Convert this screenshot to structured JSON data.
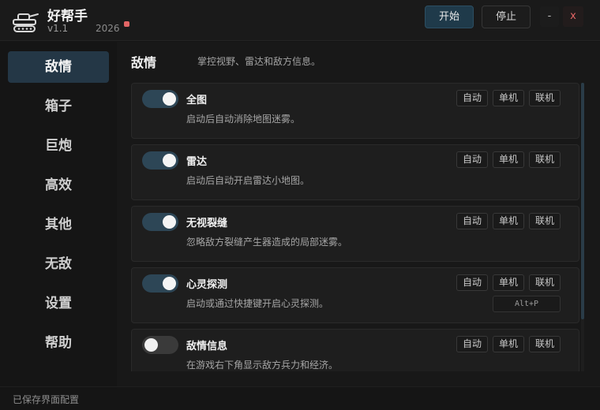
{
  "app": {
    "title": "好帮手",
    "version": "v1.1",
    "year": "2026",
    "start_label": "开始",
    "stop_label": "停止",
    "minimize_label": "-",
    "close_label": "x",
    "accent_color": "#243746",
    "status_dot_color": "#e26565",
    "logo_icon": "tank-icon"
  },
  "sidebar": {
    "items": [
      {
        "label": "敌情",
        "active": true
      },
      {
        "label": "箱子",
        "active": false
      },
      {
        "label": "巨炮",
        "active": false
      },
      {
        "label": "高效",
        "active": false
      },
      {
        "label": "其他",
        "active": false
      },
      {
        "label": "无敌",
        "active": false
      },
      {
        "label": "设置",
        "active": false
      },
      {
        "label": "帮助",
        "active": false
      }
    ]
  },
  "main": {
    "title": "敌情",
    "description": "掌控视野、雷达和敌方信息。",
    "mode_tags": [
      "自动",
      "单机",
      "联机"
    ],
    "features": [
      {
        "title": "全图",
        "description": "启动后自动消除地图迷雾。",
        "enabled": true
      },
      {
        "title": "雷达",
        "description": "启动后自动开启雷达小地图。",
        "enabled": true
      },
      {
        "title": "无视裂缝",
        "description": "忽略敌方裂缝产生器造成的局部迷雾。",
        "enabled": true
      },
      {
        "title": "心灵探测",
        "description": "启动或通过快捷键开启心灵探测。",
        "enabled": true,
        "hotkey": "Alt+P"
      },
      {
        "title": "敌情信息",
        "description": "在游戏右下角显示敌方兵力和经济。",
        "enabled": false
      }
    ]
  },
  "statusbar": {
    "text": "已保存界面配置"
  }
}
